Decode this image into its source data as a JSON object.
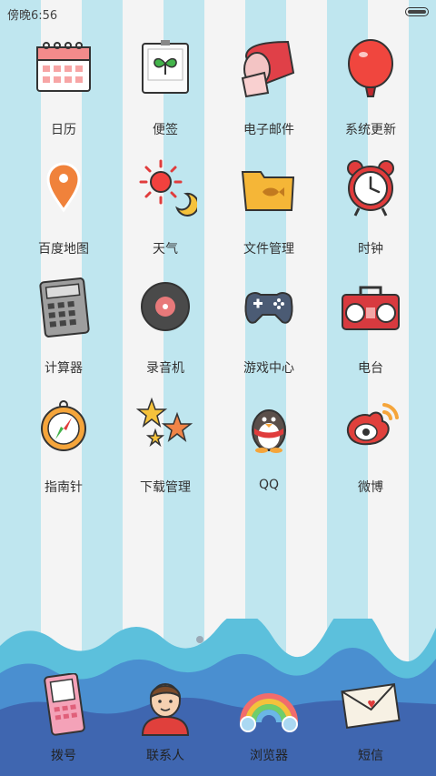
{
  "status": {
    "time": "傍晚6:56"
  },
  "apps": [
    {
      "label": "日历",
      "icon": "calendar-icon"
    },
    {
      "label": "便签",
      "icon": "notes-icon"
    },
    {
      "label": "电子邮件",
      "icon": "mailbox-icon"
    },
    {
      "label": "系统更新",
      "icon": "balloon-icon"
    },
    {
      "label": "百度地图",
      "icon": "map-pin-icon"
    },
    {
      "label": "天气",
      "icon": "weather-icon"
    },
    {
      "label": "文件管理",
      "icon": "folder-icon"
    },
    {
      "label": "时钟",
      "icon": "alarm-clock-icon"
    },
    {
      "label": "计算器",
      "icon": "calculator-icon"
    },
    {
      "label": "录音机",
      "icon": "record-icon"
    },
    {
      "label": "游戏中心",
      "icon": "gamepad-icon"
    },
    {
      "label": "电台",
      "icon": "radio-icon"
    },
    {
      "label": "指南针",
      "icon": "compass-icon"
    },
    {
      "label": "下载管理",
      "icon": "stars-icon"
    },
    {
      "label": "QQ",
      "icon": "penguin-icon"
    },
    {
      "label": "微博",
      "icon": "weibo-icon"
    }
  ],
  "dock": [
    {
      "label": "拨号",
      "icon": "phone-icon"
    },
    {
      "label": "联系人",
      "icon": "contact-icon"
    },
    {
      "label": "浏览器",
      "icon": "rainbow-icon"
    },
    {
      "label": "短信",
      "icon": "envelope-icon"
    }
  ],
  "page_indicator": {
    "pages": 3,
    "current": 2
  },
  "colors": {
    "stripe": "#bfe6ef",
    "wave_light": "#5cc0dc",
    "wave_mid": "#4a8fd0",
    "wave_dark": "#3f66b0"
  }
}
